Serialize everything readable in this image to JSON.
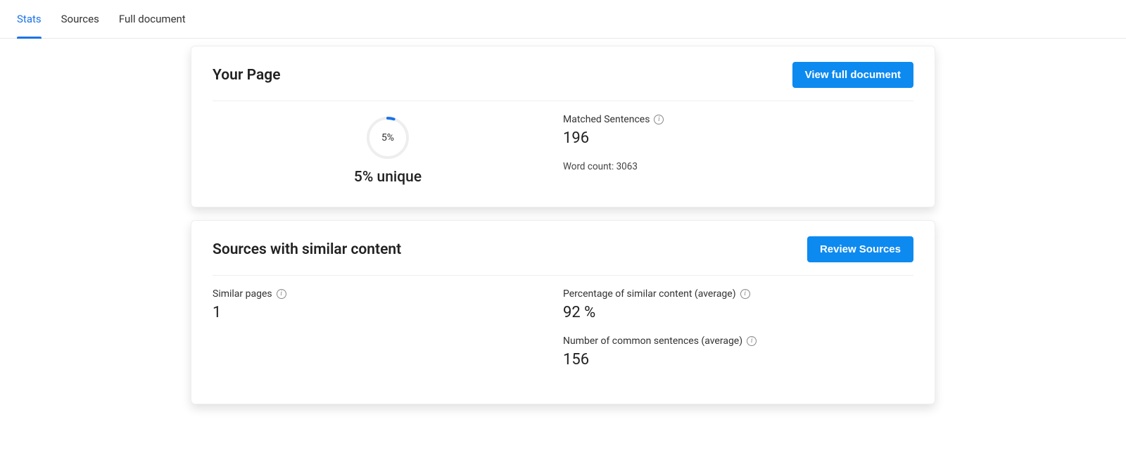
{
  "tabs": {
    "stats": "Stats",
    "sources": "Sources",
    "full_document": "Full document"
  },
  "your_page": {
    "title": "Your Page",
    "button_label": "View full document",
    "donut_percent_text": "5%",
    "donut_percent_value": 5,
    "unique_text": "5% unique",
    "matched_sentences_label": "Matched Sentences",
    "matched_sentences_value": "196",
    "word_count_text": "Word count: 3063"
  },
  "sources_card": {
    "title": "Sources with similar content",
    "button_label": "Review Sources",
    "similar_pages_label": "Similar pages",
    "similar_pages_value": "1",
    "percentage_label": "Percentage of similar content (average)",
    "percentage_value": "92 %",
    "common_sentences_label": "Number of common sentences (average)",
    "common_sentences_value": "156"
  },
  "colors": {
    "accent": "#0d8af0",
    "tab_active": "#1a73e8"
  }
}
